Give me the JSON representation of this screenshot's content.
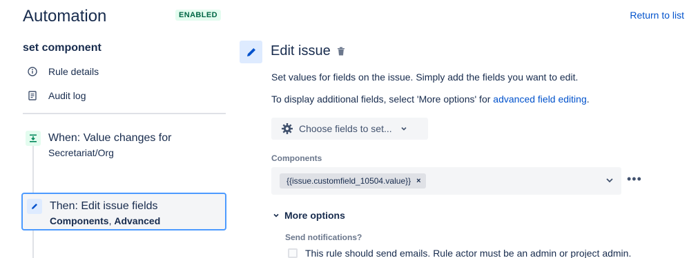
{
  "header": {
    "title": "Automation",
    "status_badge": "ENABLED",
    "return_link": "Return to list"
  },
  "sidebar": {
    "rule_name": "set component",
    "links": [
      {
        "label": "Rule details",
        "icon": "info-icon"
      },
      {
        "label": "Audit log",
        "icon": "document-icon"
      }
    ],
    "trigger": {
      "line1": "When: Value changes for",
      "line2": "Secretariat/Org",
      "icon": "trigger-icon"
    },
    "action": {
      "line1": "Then: Edit issue fields",
      "detail_part1": "Components",
      "detail_sep": ", ",
      "detail_part2": "Advanced",
      "icon": "pencil-icon"
    }
  },
  "panel": {
    "title": "Edit issue",
    "description": "Set values for fields on the issue. Simply add the fields you want to edit.",
    "additional_prefix": "To display additional fields, select 'More options' for ",
    "additional_link": "advanced field editing",
    "additional_suffix": ".",
    "choose_fields_label": "Choose fields to set...",
    "components_label": "Components",
    "components_tag": "{{issue.customfield_10504.value}}",
    "tag_remove": "×",
    "more_actions": "•••",
    "more_options_label": "More options",
    "send_notifications_label": "Send notifications?",
    "send_emails_text": "This rule should send emails. Rule actor must be an admin or project admin."
  },
  "colors": {
    "link": "#0052cc",
    "badge_bg": "#e3fcef",
    "badge_text": "#006644",
    "selected_border": "#4c9aff"
  }
}
